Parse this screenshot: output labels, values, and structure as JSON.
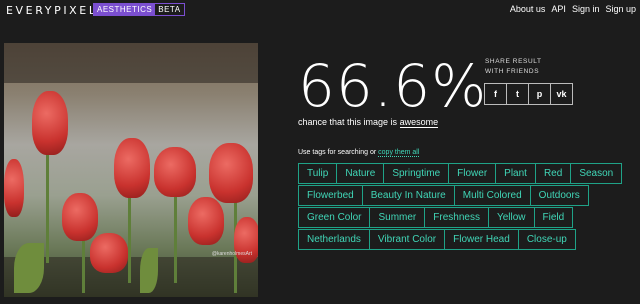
{
  "header": {
    "logo": "EVERYPIXEL",
    "badge_main": "AESTHETICS",
    "badge_beta": "BETA",
    "nav": [
      "About us",
      "API",
      "Sign in",
      "Sign up"
    ]
  },
  "image": {
    "watermark": "@karenholmesArt"
  },
  "result": {
    "score": "66.6%",
    "chance_prefix": "chance that this image is",
    "chance_word": "awesome"
  },
  "share": {
    "title": "SHARE RESULT WITH FRIENDS",
    "buttons": [
      {
        "icon": "facebook-icon",
        "glyph": "f"
      },
      {
        "icon": "twitter-icon",
        "glyph": "t"
      },
      {
        "icon": "pinterest-icon",
        "glyph": "p"
      },
      {
        "icon": "vk-icon",
        "glyph": "vk"
      }
    ]
  },
  "tags_section": {
    "hint": "Use tags for searching or",
    "copy_link": "copy them all",
    "tags": [
      "Tulip",
      "Nature",
      "Springtime",
      "Flower",
      "Plant",
      "Red",
      "Season",
      "Flowerbed",
      "Beauty In Nature",
      "Multi Colored",
      "Outdoors",
      "Green Color",
      "Summer",
      "Freshness",
      "Yellow",
      "Field",
      "Netherlands",
      "Vibrant Color",
      "Flower Head",
      "Close-up"
    ]
  },
  "colors": {
    "accent": "#40d6b7",
    "badge": "#7b4fd0",
    "background": "#1c1c1c"
  }
}
